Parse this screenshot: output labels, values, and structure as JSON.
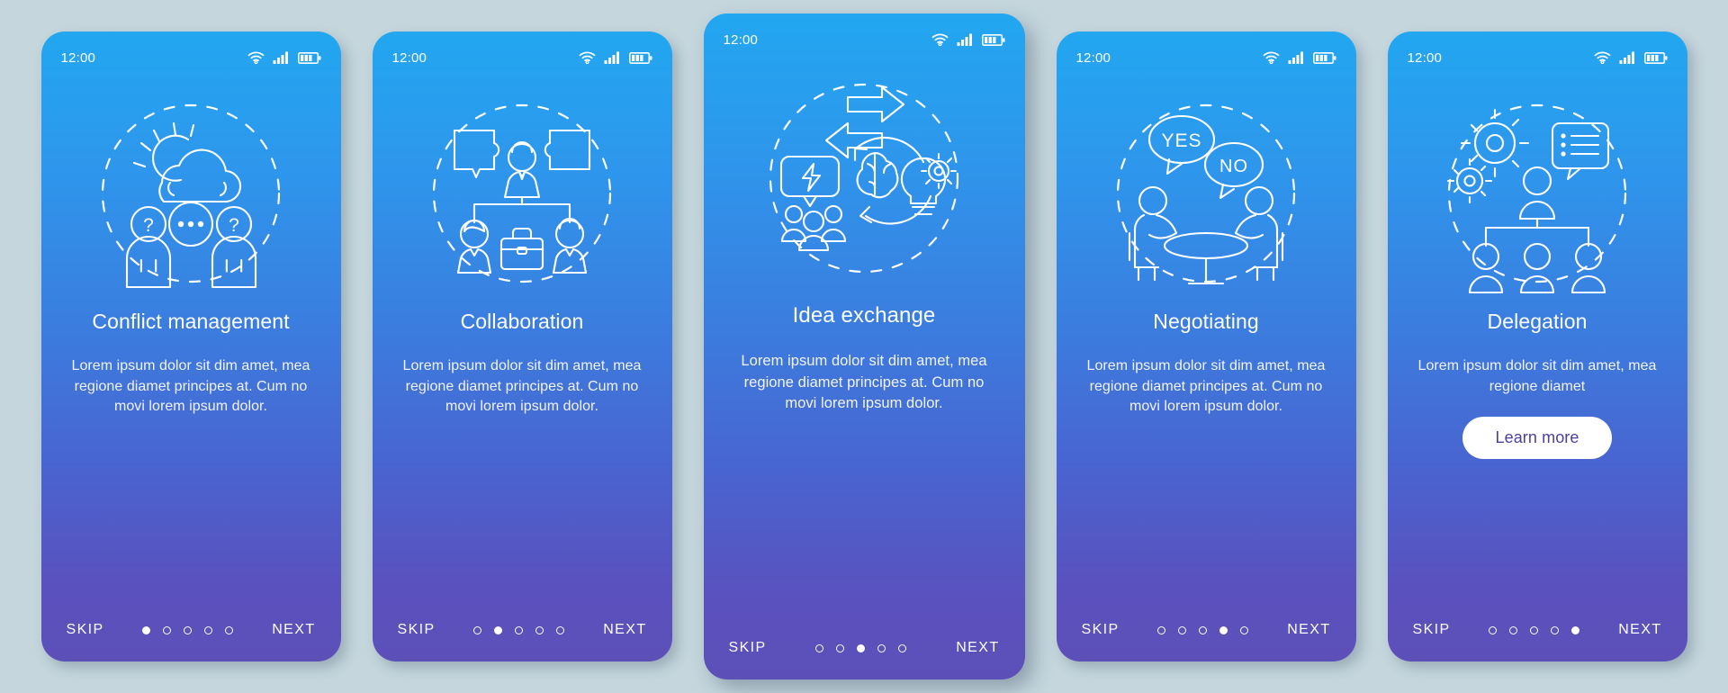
{
  "page": {
    "background_color": "#c5d6dd",
    "card_gradient_top": "#22a7f0",
    "card_gradient_bottom": "#5d4fb8",
    "accent_text_color": "#4a3fa5"
  },
  "status_bar": {
    "time": "12:00",
    "icons": [
      "wifi-icon",
      "cellular-signal-icon",
      "battery-icon"
    ]
  },
  "nav": {
    "skip_label": "SKIP",
    "next_label": "NEXT",
    "dot_count": 5
  },
  "screens": [
    {
      "id": "conflict-management",
      "title": "Conflict management",
      "body": "Lorem ipsum dolor sit dim amet, mea regione diamet principes at. Cum no movi lorem ipsum dolor.",
      "illustration": "sun-cloud-two-people-question-marks-icon",
      "active_dot": 1,
      "featured": false,
      "cta": null
    },
    {
      "id": "collaboration",
      "title": "Collaboration",
      "body": "Lorem ipsum dolor sit dim amet, mea regione diamet principes at. Cum no movi lorem ipsum dolor.",
      "illustration": "puzzle-pieces-team-org-chart-briefcase-icon",
      "active_dot": 2,
      "featured": false,
      "cta": null
    },
    {
      "id": "idea-exchange",
      "title": "Idea exchange",
      "body": "Lorem ipsum dolor sit dim amet, mea regione diamet principes at. Cum no movi lorem ipsum dolor.",
      "illustration": "arrows-lightning-group-brain-lightbulb-gear-icon",
      "active_dot": 3,
      "featured": true,
      "cta": null
    },
    {
      "id": "negotiating",
      "title": "Negotiating",
      "body": "Lorem ipsum dolor sit dim amet, mea regione diamet principes at. Cum no movi lorem ipsum dolor.",
      "illustration": "two-people-table-yes-no-speech-bubbles-icon",
      "active_dot": 4,
      "featured": false,
      "cta": null,
      "bubble_yes": "YES",
      "bubble_no": "NO"
    },
    {
      "id": "delegation",
      "title": "Delegation",
      "body": "Lorem ipsum dolor sit dim amet, mea regione diamet",
      "illustration": "gears-org-chart-checklist-icon",
      "active_dot": 5,
      "featured": false,
      "cta": "Learn more"
    }
  ]
}
